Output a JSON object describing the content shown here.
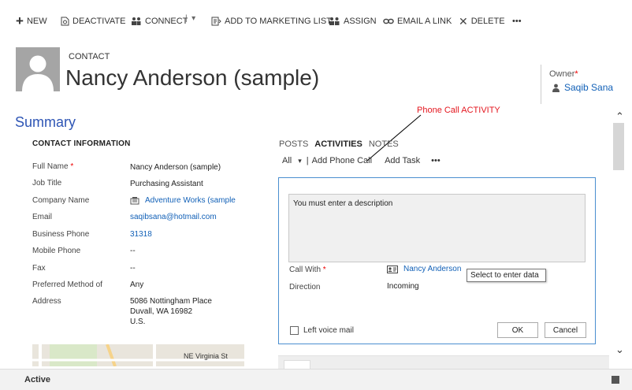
{
  "commands": {
    "new": "NEW",
    "deactivate": "DEACTIVATE",
    "connect": "CONNECT",
    "add_to_marketing_list": "ADD TO MARKETING LIST",
    "assign": "ASSIGN",
    "email_a_link": "EMAIL A LINK",
    "delete": "DELETE",
    "more": "•••"
  },
  "header": {
    "entity_type": "CONTACT",
    "record_name": "Nancy Anderson (sample)",
    "owner_label": "Owner",
    "owner_value": "Saqib Sana"
  },
  "annotation": "Phone Call ACTIVITY",
  "section_title": "Summary",
  "contact_info": {
    "header": "CONTACT INFORMATION",
    "fields": [
      {
        "label": "Full Name",
        "value": "Nancy Anderson (sample)"
      },
      {
        "label": "Job Title",
        "value": "Purchasing Assistant"
      },
      {
        "label": "Company Name",
        "value": "Adventure Works (sample"
      },
      {
        "label": "Email",
        "value": "saqibsana@hotmail.com"
      },
      {
        "label": "Business Phone",
        "value": "31318"
      },
      {
        "label": "Mobile Phone",
        "value": "--"
      },
      {
        "label": "Fax",
        "value": "--"
      },
      {
        "label": "Preferred Method of",
        "value": "Any"
      },
      {
        "label": "Address",
        "value": "5086 Nottingham Place"
      }
    ],
    "address_line2": "Duvall, WA 16982",
    "address_line3": "U.S.",
    "map_label": "NE Virginia St"
  },
  "activities": {
    "tabs": [
      "POSTS",
      "ACTIVITIES",
      "NOTES"
    ],
    "filter_all": "All",
    "add_phone_call": "Add Phone Call",
    "add_task": "Add Task",
    "more": "•••",
    "description": "You must enter a description",
    "call_with_label": "Call With",
    "call_with_value": "Nancy Anderson",
    "tooltip": "Select to enter data",
    "direction_label": "Direction",
    "direction_value": "Incoming",
    "left_voice_mail": "Left voice mail",
    "ok": "OK",
    "cancel": "Cancel"
  },
  "status": {
    "text": "Active"
  }
}
